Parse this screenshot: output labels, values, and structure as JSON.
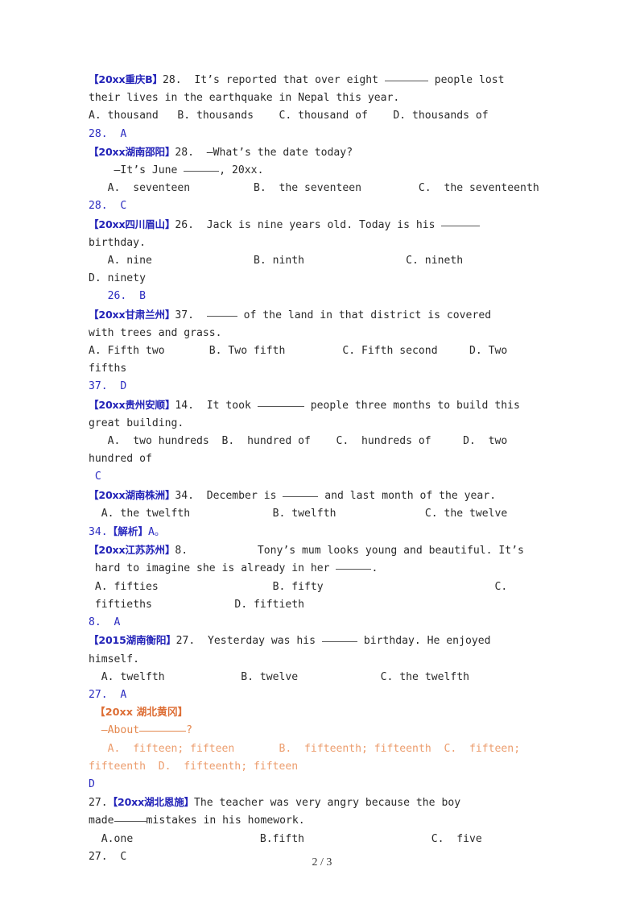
{
  "document": {
    "page_label": "2 / 3",
    "colors": {
      "source_tag_blue": "#2323b8",
      "answer_blue": "#2c2cc0",
      "body_text": "#2a2a2a",
      "orange_heading": "#dd6e35",
      "orange_text": "#e4874d",
      "orange_light": "#ec9d6e"
    }
  },
  "questions": [
    {
      "source": "【20xx重庆B】",
      "stem_a": "28.  It’s reported that over eight ",
      "stem_b": " people lost",
      "stem_line2": "their lives in the earthquake in Nepal this year.",
      "options_line1": "A. thousand   B. thousands    C. thousand of    D. thousands of",
      "answer": "28.  A"
    },
    {
      "source": "【20xx湖南邵阳】",
      "stem_a": "28.  —What’s the date today?",
      "stem_line2": "—It’s June ",
      "stem_line2b": ", 20xx.",
      "options_line1": "A.  seventeen          B.  the seventeen         C.  the seventeenth",
      "answer": "28.  C"
    },
    {
      "source": "【20xx四川眉山】",
      "stem_a": "26.  Jack is nine years old. Today is his ",
      "stem_line2": "birthday.",
      "options_line1": "A. nine                B. ninth                C. nineth",
      "options_line2": "D. ninety",
      "answer": "26.  B"
    },
    {
      "source": "【20xx甘肃兰州】",
      "stem_a": "37.  ",
      "stem_b": " of the land in that district is covered",
      "stem_line2": "with trees and grass.",
      "options_line1": "A. Fifth two       B. Two fifth         C. Fifth second     D. Two",
      "options_line2": "fifths",
      "answer": "37.  D"
    },
    {
      "source": "【20xx贵州安顺】",
      "stem_a": "14.  It took ",
      "stem_b": " people three months to build this",
      "stem_line2": "great building.",
      "options_line1": "A.  two hundreds  B.  hundred of    C.  hundreds of     D.  two",
      "options_line2": "hundred of",
      "answer": "C"
    },
    {
      "source": "【20xx湖南株洲】",
      "stem_a": "34.  December is ",
      "stem_b": " and last month of the year.",
      "options_line1": "A. the twelfth             B. twelfth              C. the twelve",
      "answer_prefix": "34.",
      "answer_cn": "【解析】",
      "answer_suffix": "A。"
    },
    {
      "source": "【20xx江苏苏州】",
      "stem_a": "8.           Tony’s mum looks young and beautiful. It’s",
      "stem_line2a": "hard to imagine she is already in her ",
      "stem_line2b": ".",
      "options_line1": "A. fifties                  B. fifty                           C.",
      "options_line2": "fiftieths             D. fiftieth",
      "answer": "8.  A"
    },
    {
      "source": "【2015湖南衡阳】",
      "stem_a": "27.  Yesterday was his ",
      "stem_b": " birthday. He enjoyed",
      "stem_line2": "himself.",
      "options_line1": "A. twelfth            B. twelve             C. the twelfth",
      "answer": "27.  A"
    },
    {
      "source": "【20xx 湖北黄冈】",
      "stem_line2a": "—About",
      "stem_line2b": "?",
      "options_line1a": "A.  fifteen; fifteen",
      "options_line1b": "B.  fifteenth; fifteenth  C.  fifteen;",
      "options_line2": "fifteenth  D.  fifteenth; fifteen",
      "answer": "D",
      "is_orange": true
    },
    {
      "number_prefix": "27.",
      "source": "【20xx湖北恩施】",
      "stem_a": "The teacher was very angry because the boy",
      "stem_line2a": "made",
      "stem_line2b": "mistakes in his homework.",
      "options_line1": "A.one                    B.fifth                    C.  five",
      "answer": "27.  C"
    }
  ]
}
